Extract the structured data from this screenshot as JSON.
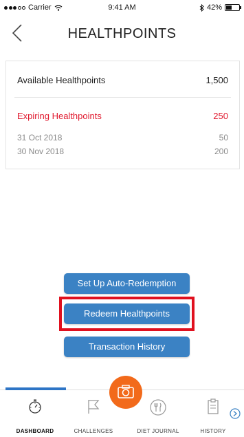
{
  "status": {
    "carrier": "Carrier",
    "time": "9:41 AM",
    "battery": "42%",
    "battery_level": 0.42
  },
  "nav": {
    "title": "HEALTHPOINTS"
  },
  "summary": {
    "available_label": "Available Healthpoints",
    "available_value": "1,500",
    "expiring_label": "Expiring Healthpoints",
    "expiring_value": "250",
    "expiring_items": [
      {
        "date": "31 Oct 2018",
        "points": "50"
      },
      {
        "date": "30 Nov 2018",
        "points": "200"
      }
    ]
  },
  "actions": {
    "auto_redemption": "Set Up Auto-Redemption",
    "redeem": "Redeem Healthpoints",
    "history": "Transaction History"
  },
  "tabs": [
    {
      "label": "DASHBOARD",
      "icon": "stopwatch-icon"
    },
    {
      "label": "CHALLENGES",
      "icon": "flag-icon"
    },
    {
      "label": "DIET JOURNAL",
      "icon": "cutlery-icon"
    },
    {
      "label": "HISTORY",
      "icon": "clipboard-icon"
    }
  ],
  "colors": {
    "accent": "#3b82c4",
    "red": "#e0182d",
    "camera": "#f26a1b",
    "highlight": "#e0101e"
  }
}
